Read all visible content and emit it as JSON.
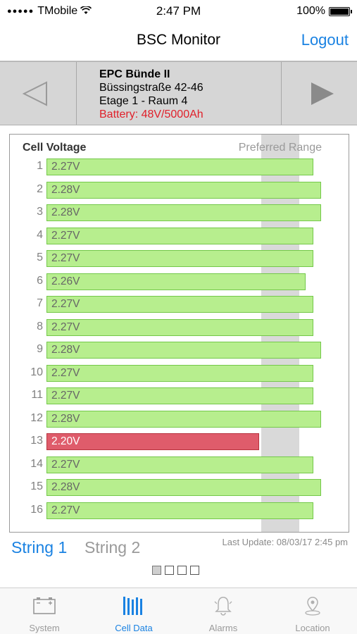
{
  "status_bar": {
    "carrier": "TMobile",
    "time": "2:47 PM",
    "battery_percent": "100%"
  },
  "nav": {
    "title": "BSC Monitor",
    "logout_label": "Logout"
  },
  "location": {
    "name": "EPC Bünde II",
    "street": "Büssingstraße 42-46",
    "floor_room": "Etage 1 - Raum 4",
    "battery": "Battery: 48V/5000Ah"
  },
  "chart_data": {
    "type": "bar",
    "orientation": "horizontal",
    "title": "Cell Voltage",
    "range_label": "Preferred Range",
    "categories": [
      "1",
      "2",
      "3",
      "4",
      "5",
      "6",
      "7",
      "8",
      "9",
      "10",
      "11",
      "12",
      "13",
      "14",
      "15",
      "16"
    ],
    "values": [
      2.27,
      2.28,
      2.28,
      2.27,
      2.27,
      2.26,
      2.27,
      2.27,
      2.28,
      2.27,
      2.27,
      2.28,
      2.2,
      2.27,
      2.28,
      2.27
    ],
    "value_labels": [
      "2.27V",
      "2.28V",
      "2.28V",
      "2.27V",
      "2.27V",
      "2.26V",
      "2.27V",
      "2.27V",
      "2.28V",
      "2.27V",
      "2.27V",
      "2.28V",
      "2.20V",
      "2.27V",
      "2.28V",
      "2.27V"
    ],
    "alarm_index": 12,
    "colors": {
      "normal": "#b7ee8e",
      "alarm": "#df5c6b",
      "range": "#d9d9d9"
    }
  },
  "strings": {
    "tabs": [
      "String 1",
      "String 2"
    ],
    "active": 0,
    "last_update": "Last Update: 08/03/17 2:45 pm"
  },
  "pager": {
    "count": 4,
    "active": 0
  },
  "tab_bar": {
    "active": 1,
    "items": [
      {
        "label": "System",
        "icon": "battery-icon"
      },
      {
        "label": "Cell Data",
        "icon": "bars-icon"
      },
      {
        "label": "Alarms",
        "icon": "bell-icon"
      },
      {
        "label": "Location",
        "icon": "pin-icon"
      }
    ]
  },
  "colors": {
    "accent": "#1a82e2",
    "alert": "#e0202a"
  }
}
